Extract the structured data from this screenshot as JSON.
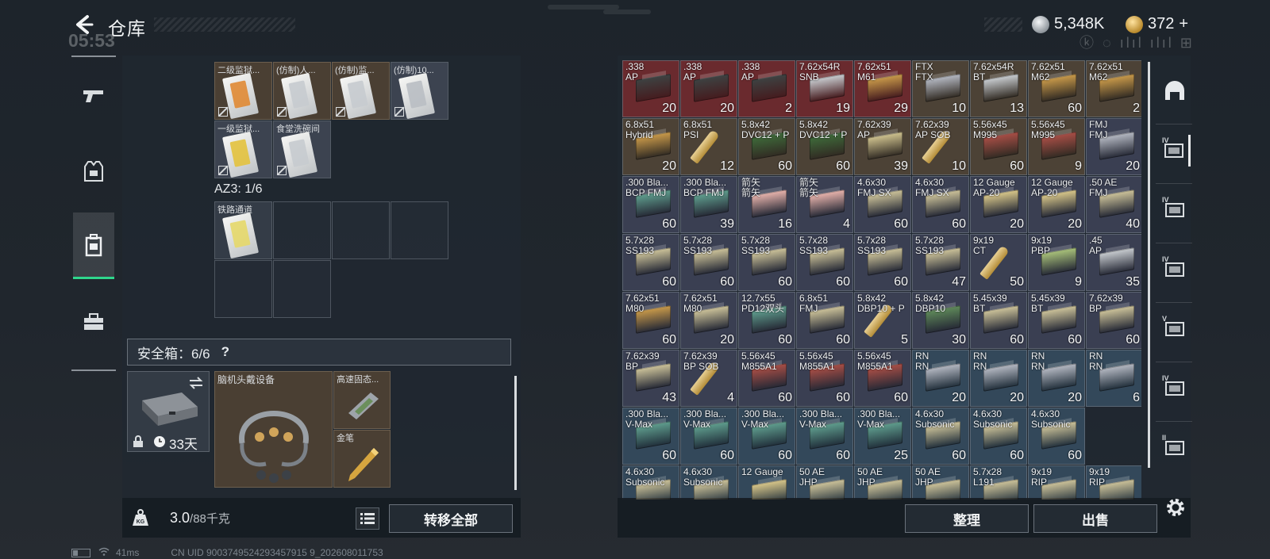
{
  "header": {
    "title": "仓库",
    "ghost_clock": "05:53",
    "currency_silver": "5,348K",
    "currency_gold": "372",
    "add_symbol": "+",
    "ghost_status": "ⓚ ◌ ılıl ılıl ⊞"
  },
  "nav": [
    {
      "name": "weapons",
      "icon": "pistol-icon"
    },
    {
      "name": "gear",
      "icon": "armor-vest-icon"
    },
    {
      "name": "containers",
      "icon": "case-icon"
    },
    {
      "name": "supplies",
      "icon": "toolbox-icon"
    }
  ],
  "keycards": [
    {
      "label": "二级监狱...",
      "color": "#e08a34"
    },
    {
      "label": "(仿制)人...",
      "color": "#c7cbcf"
    },
    {
      "label": "(仿制)监...",
      "color": "#c7cbcf"
    },
    {
      "label": "(仿制)10...",
      "color": "#b9bec3"
    },
    {
      "label": "一级监狱...",
      "color": "#e3c23e"
    },
    {
      "label": "食堂洗碗间",
      "color": "#c7cbcf"
    }
  ],
  "az3": {
    "label": "AZ3: 1/6"
  },
  "rail_card": {
    "label": "铁路通道",
    "color": "#e6d86a"
  },
  "safe_box": {
    "label": "安全箱：6/6",
    "help": "?",
    "days": "33天",
    "items": [
      {
        "label": "脑机头戴设备"
      },
      {
        "label": "高速固态..."
      },
      {
        "label": "金笔"
      }
    ]
  },
  "weight": {
    "current": "3.0",
    "capacity": "/88千克"
  },
  "buttons": {
    "transfer_all": "转移全部",
    "sort": "整理",
    "sell": "出售"
  },
  "stash_rows": [
    [
      {
        "label": ".338\nAP",
        "count": "20",
        "bg": "#6a2a2e",
        "item": "#3d4242"
      },
      {
        "label": ".338\nAP",
        "count": "20",
        "bg": "#6a2a2e",
        "item": "#3d4242"
      },
      {
        "label": ".338\nAP",
        "count": "2",
        "bg": "#6a2a2e",
        "item": "#3d4242"
      },
      {
        "label": "7.62x54R\nSNB",
        "count": "19",
        "bg": "#6a2a2e",
        "item": "#c8ccd0"
      },
      {
        "label": "7.62x51\nM61",
        "count": "29",
        "bg": "#6a2a2e",
        "item": "#c99a4a"
      },
      {
        "label": "FTX\nFTX",
        "count": "10",
        "bg": "#4c4236",
        "item": "#b4b8c2"
      },
      {
        "label": "7.62x54R\nBT",
        "count": "13",
        "bg": "#4c4236",
        "item": "#c8ccd0"
      },
      {
        "label": "7.62x51\nM62",
        "count": "60",
        "bg": "#4c4236",
        "item": "#c99a4a"
      },
      {
        "label": "7.62x51\nM62",
        "count": "2",
        "bg": "#4c4236",
        "item": "#c99a4a"
      }
    ],
    [
      {
        "label": "6.8x51\nHybrid",
        "count": "20",
        "bg": "#4c4236",
        "item": "#c99a4a"
      },
      {
        "label": "6.8x51\nPSI",
        "count": "12",
        "bg": "#4c4236",
        "item": "#e0e0dc"
      },
      {
        "label": "5.8x42\nDVC12 + P",
        "count": "60",
        "bg": "#4c4236",
        "item": "#3e6a3a"
      },
      {
        "label": "5.8x42\nDVC12 + P",
        "count": "60",
        "bg": "#4c4236",
        "item": "#3e6a3a"
      },
      {
        "label": "7.62x39\nAP",
        "count": "39",
        "bg": "#4c4236",
        "item": "#cfc28f"
      },
      {
        "label": "7.62x39\nAP SOB",
        "count": "10",
        "bg": "#4c4236",
        "item": "#3e6a3a"
      },
      {
        "label": "5.56x45\nM995",
        "count": "60",
        "bg": "#4c4236",
        "item": "#a84e46"
      },
      {
        "label": "5.56x45\nM995",
        "count": "9",
        "bg": "#4c4236",
        "item": "#a84e46"
      },
      {
        "label": "FMJ\nFMJ",
        "count": "20",
        "bg": "#3a3f52",
        "item": "#b4b8c2"
      }
    ],
    [
      {
        "label": ".300 Bla...\nBCP FMJ",
        "count": "60",
        "bg": "#3a3f52",
        "item": "#5f9e8e"
      },
      {
        "label": ".300 Bla...\nBCP FMJ",
        "count": "39",
        "bg": "#3a3f52",
        "item": "#5f9e8e"
      },
      {
        "label": "箭矢\n箭矢",
        "count": "16",
        "bg": "#3a3f52",
        "item": "#e8b3ac"
      },
      {
        "label": "箭矢\n箭矢",
        "count": "4",
        "bg": "#3a3f52",
        "item": "#e8b3ac"
      },
      {
        "label": "4.6x30\nFMJ SX",
        "count": "60",
        "bg": "#3a3f52",
        "item": "#cdc39a"
      },
      {
        "label": "4.6x30\nFMJ SX",
        "count": "60",
        "bg": "#3a3f52",
        "item": "#cdc39a"
      },
      {
        "label": "12 Gauge\nAP-20",
        "count": "20",
        "bg": "#3a3f52",
        "item": "#d9c78a"
      },
      {
        "label": "12 Gauge\nAP-20",
        "count": "20",
        "bg": "#3a3f52",
        "item": "#d9c78a"
      },
      {
        "label": ".50 AE\nFMJ",
        "count": "40",
        "bg": "#3a3f52",
        "item": "#cdc39a"
      }
    ],
    [
      {
        "label": "5.7x28\nSS193",
        "count": "60",
        "bg": "#3a3f52",
        "item": "#cdc39a"
      },
      {
        "label": "5.7x28\nSS193",
        "count": "60",
        "bg": "#3a3f52",
        "item": "#cdc39a"
      },
      {
        "label": "5.7x28\nSS193",
        "count": "60",
        "bg": "#3a3f52",
        "item": "#cdc39a"
      },
      {
        "label": "5.7x28\nSS193",
        "count": "60",
        "bg": "#3a3f52",
        "item": "#cdc39a"
      },
      {
        "label": "5.7x28\nSS193",
        "count": "60",
        "bg": "#3a3f52",
        "item": "#cdc39a"
      },
      {
        "label": "5.7x28\nSS193",
        "count": "47",
        "bg": "#3a3f52",
        "item": "#cdc39a"
      },
      {
        "label": "9x19\nCT",
        "count": "50",
        "bg": "#3a3f52",
        "item": "#d8a86a"
      },
      {
        "label": "9x19\nPBP",
        "count": "9",
        "bg": "#3a3f52",
        "item": "#a9c27a"
      },
      {
        "label": ".45\nAP",
        "count": "35",
        "bg": "#3a3f52",
        "item": "#c8ccd0"
      }
    ],
    [
      {
        "label": "7.62x51\nM80",
        "count": "60",
        "bg": "#3a3f52",
        "item": "#c99a4a"
      },
      {
        "label": "7.62x51\nM80",
        "count": "20",
        "bg": "#3a3f52",
        "item": "#cdc39a"
      },
      {
        "label": "12.7x55\nPD12双头",
        "count": "60",
        "bg": "#3a3f52",
        "item": "#5f9e8e"
      },
      {
        "label": "6.8x51\nFMJ",
        "count": "60",
        "bg": "#3a3f52",
        "item": "#cdc39a"
      },
      {
        "label": "5.8x42\nDBP10 + P",
        "count": "5",
        "bg": "#3a3f52",
        "item": "#3e6a3a"
      },
      {
        "label": "5.8x42\nDBP10",
        "count": "30",
        "bg": "#3a3f52",
        "item": "#5f8a5a"
      },
      {
        "label": "5.45x39\nBT",
        "count": "60",
        "bg": "#3a3f52",
        "item": "#cdc39a"
      },
      {
        "label": "5.45x39\nBT",
        "count": "60",
        "bg": "#3a3f52",
        "item": "#cdc39a"
      },
      {
        "label": "7.62x39\nBP",
        "count": "60",
        "bg": "#3a3f52",
        "item": "#cdc39a"
      }
    ],
    [
      {
        "label": "7.62x39\nBP",
        "count": "43",
        "bg": "#3a3f52",
        "item": "#cdc39a"
      },
      {
        "label": "7.62x39\nBP SOB",
        "count": "4",
        "bg": "#3a3f52",
        "item": "#3e6a3a"
      },
      {
        "label": "5.56x45\nM855A1",
        "count": "60",
        "bg": "#3a3f52",
        "item": "#a84e46"
      },
      {
        "label": "5.56x45\nM855A1",
        "count": "60",
        "bg": "#3a3f52",
        "item": "#a84e46"
      },
      {
        "label": "5.56x45\nM855A1",
        "count": "60",
        "bg": "#3a3f52",
        "item": "#a84e46"
      },
      {
        "label": "RN\nRN",
        "count": "20",
        "bg": "#33485a",
        "item": "#b4b8c2"
      },
      {
        "label": "RN\nRN",
        "count": "20",
        "bg": "#33485a",
        "item": "#b4b8c2"
      },
      {
        "label": "RN\nRN",
        "count": "20",
        "bg": "#33485a",
        "item": "#b4b8c2"
      },
      {
        "label": "RN\nRN",
        "count": "6",
        "bg": "#33485a",
        "item": "#b4b8c2"
      }
    ],
    [
      {
        "label": ".300 Bla...\nV-Max",
        "count": "60",
        "bg": "#33485a",
        "item": "#5f9e8e"
      },
      {
        "label": ".300 Bla...\nV-Max",
        "count": "60",
        "bg": "#33485a",
        "item": "#5f9e8e"
      },
      {
        "label": ".300 Bla...\nV-Max",
        "count": "60",
        "bg": "#33485a",
        "item": "#5f9e8e"
      },
      {
        "label": ".300 Bla...\nV-Max",
        "count": "60",
        "bg": "#33485a",
        "item": "#5f9e8e"
      },
      {
        "label": ".300 Bla...\nV-Max",
        "count": "25",
        "bg": "#33485a",
        "item": "#5f9e8e"
      },
      {
        "label": "4.6x30\nSubsonic",
        "count": "60",
        "bg": "#33485a",
        "item": "#cdc39a"
      },
      {
        "label": "4.6x30\nSubsonic",
        "count": "60",
        "bg": "#33485a",
        "item": "#cdc39a"
      },
      {
        "label": "4.6x30\nSubsonic",
        "count": "60",
        "bg": "#33485a",
        "item": "#cdc39a"
      }
    ],
    [
      {
        "label": "4.6x30\nSubsonic",
        "count": "",
        "bg": "#33485a",
        "item": "#cdc39a"
      },
      {
        "label": "4.6x30\nSubsonic",
        "count": "",
        "bg": "#33485a",
        "item": "#cdc39a"
      },
      {
        "label": "12 Gauge\n",
        "count": "",
        "bg": "#33485a",
        "item": "#d9c78a"
      },
      {
        "label": "50 AE\nJHP",
        "count": "",
        "bg": "#33485a",
        "item": "#cdc39a"
      },
      {
        "label": "50 AE\nJHP",
        "count": "",
        "bg": "#33485a",
        "item": "#cdc39a"
      },
      {
        "label": "50 AE\nJHP",
        "count": "",
        "bg": "#33485a",
        "item": "#cdc39a"
      },
      {
        "label": "5.7x28\nL191",
        "count": "",
        "bg": "#33485a",
        "item": "#cdc39a"
      },
      {
        "label": "9x19\nRIP",
        "count": "",
        "bg": "#33485a",
        "item": "#cdc39a"
      },
      {
        "label": "9x19\nRIP",
        "count": "",
        "bg": "#33485a",
        "item": "#cdc39a"
      }
    ]
  ],
  "side_tabs": [
    {
      "level": "",
      "icon": "helmet-icon"
    },
    {
      "level": "IV",
      "icon": "stash-page-icon"
    },
    {
      "level": "IV",
      "icon": "stash-page-icon"
    },
    {
      "level": "IV",
      "icon": "stash-page-icon"
    },
    {
      "level": "V",
      "icon": "stash-page-icon"
    },
    {
      "level": "IV",
      "icon": "stash-page-icon"
    },
    {
      "level": "II",
      "icon": "stash-page-icon"
    }
  ],
  "footer": {
    "ping": "41ms",
    "uid": "CN UID 9003749524293457915 9_202608011753"
  }
}
